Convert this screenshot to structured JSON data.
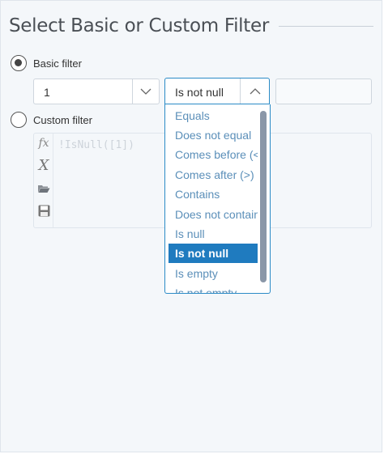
{
  "header": {
    "title": "Select Basic or Custom Filter"
  },
  "basic_filter": {
    "label": "Basic filter",
    "selected": true,
    "field_value": "1",
    "operator_value": "Is not null",
    "value_input": ""
  },
  "operator_dropdown": {
    "items": [
      {
        "label": "Equals"
      },
      {
        "label": "Does not equal"
      },
      {
        "label": "Comes before (<"
      },
      {
        "label": "Comes after (>)"
      },
      {
        "label": "Contains"
      },
      {
        "label": "Does not contain"
      },
      {
        "label": "Is null"
      },
      {
        "label": "Is not null"
      },
      {
        "label": "Is empty"
      },
      {
        "label": "Is not empty"
      }
    ],
    "selected_index": 7
  },
  "custom_filter": {
    "label": "Custom filter",
    "selected": false,
    "expression": "!IsNull([1])",
    "tools": [
      {
        "icon": "function-icon",
        "glyph": "fx"
      },
      {
        "icon": "variable-icon",
        "glyph": "X"
      },
      {
        "icon": "folder-open-icon",
        "glyph": ""
      },
      {
        "icon": "save-icon",
        "glyph": ""
      }
    ]
  },
  "colors": {
    "accent": "#2b8bc6",
    "selected_item_bg": "#1f7bbf",
    "dropdown_text": "#5b8fb9"
  }
}
